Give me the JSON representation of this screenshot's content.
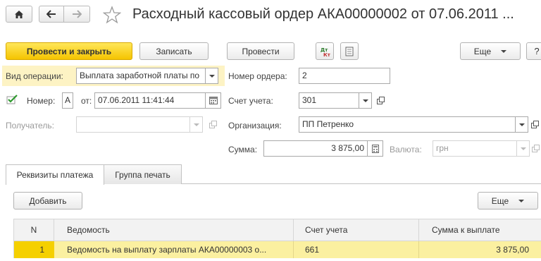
{
  "window": {
    "title": "Расходный кассовый ордер АКА00000002 от 07.06.2011 ..."
  },
  "toolbar": {
    "post_close_label": "Провести и закрыть",
    "save_label": "Записать",
    "post_label": "Провести",
    "more_label": "Еще",
    "help_label": "?"
  },
  "form": {
    "operation_label": "Вид операции:",
    "operation_value": "Выплата заработной платы по",
    "number_label": "Номер:",
    "number_prefix": "А",
    "date_label": "от:",
    "date_value": "07.06.2011 11:41:44",
    "recipient_label": "Получатель:",
    "recipient_value": "",
    "order_number_label": "Номер ордера:",
    "order_number_value": "2",
    "account_label": "Счет учета:",
    "account_value": "301",
    "org_label": "Организация:",
    "org_value": "ПП Петренко",
    "sum_label": "Сумма:",
    "sum_value": "3 875,00",
    "currency_label": "Валюта:",
    "currency_value": "грн"
  },
  "tabs": [
    {
      "label": "Реквизиты платежа",
      "active": true
    },
    {
      "label": "Группа печать",
      "active": false
    }
  ],
  "table_toolbar": {
    "add_label": "Добавить",
    "more_label": "Еще"
  },
  "table": {
    "columns": [
      "N",
      "Ведомость",
      "Счет учета",
      "Сумма к выплате"
    ],
    "rows": [
      {
        "n": "1",
        "statement": "Ведомость на выплату зарплаты АКА00000003 о...",
        "account": "661",
        "amount": "3 875,00"
      }
    ]
  },
  "colors": {
    "primary_button": "#f5c400",
    "highlight_row": "#fbf0a0",
    "field_highlight": "#fdf3c4"
  }
}
